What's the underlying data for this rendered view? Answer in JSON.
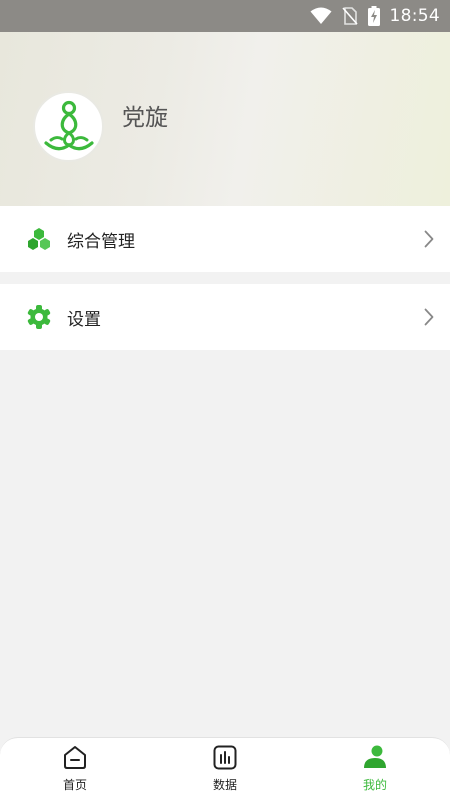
{
  "status_bar": {
    "time": "18:54",
    "icons": [
      "wifi-icon",
      "no-sim-icon",
      "battery-charging-icon"
    ]
  },
  "profile": {
    "username": "党旋",
    "avatar_icon": "yoga-meditation-icon"
  },
  "menu": [
    {
      "label": "综合管理",
      "icon": "cubes-icon"
    },
    {
      "label": "设置",
      "icon": "gear-icon"
    }
  ],
  "tabs": [
    {
      "label": "首页",
      "icon": "home-icon",
      "active": false
    },
    {
      "label": "数据",
      "icon": "bar-chart-icon",
      "active": false
    },
    {
      "label": "我的",
      "icon": "user-icon",
      "active": true
    }
  ],
  "colors": {
    "accent": "#3cb93c",
    "status_bar": "#8c8a86",
    "page_background": "#f2f2f2"
  }
}
